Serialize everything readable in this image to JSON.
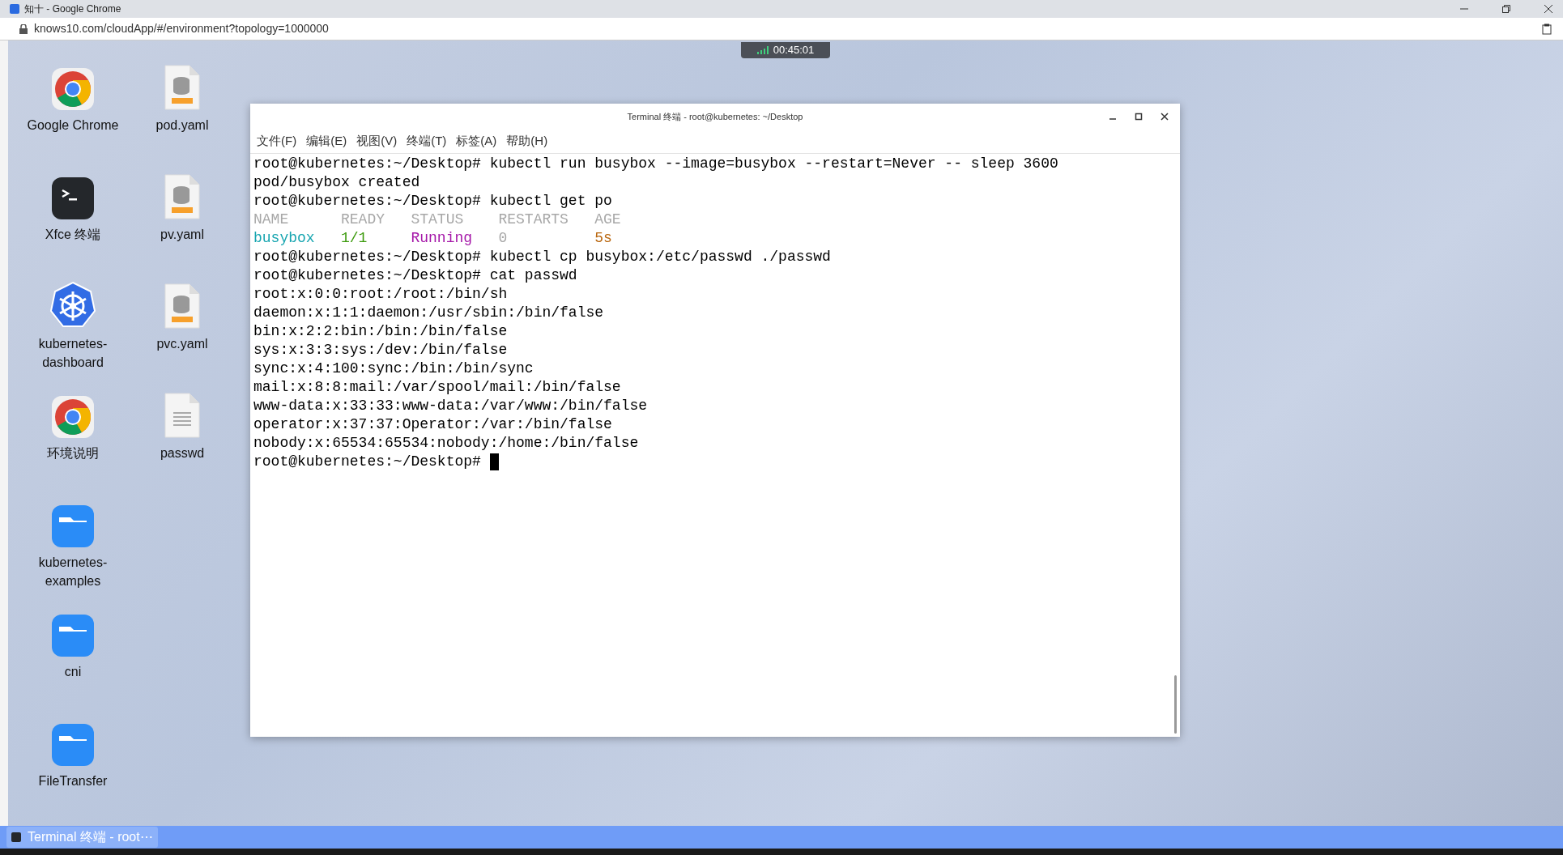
{
  "browser": {
    "title": "知十 - Google Chrome",
    "url": "knows10.com/cloudApp/#/environment?topology=1000000"
  },
  "session_timer": "00:45:01",
  "desktop_icons": [
    {
      "label": "Google Chrome",
      "kind": "chrome"
    },
    {
      "label": "pod.yaml",
      "kind": "yaml"
    },
    {
      "label": "Xfce 终端",
      "kind": "terminal"
    },
    {
      "label": "pv.yaml",
      "kind": "yaml"
    },
    {
      "label": "kubernetes-dashboard",
      "kind": "kubernetes"
    },
    {
      "label": "pvc.yaml",
      "kind": "yaml"
    },
    {
      "label": "环境说明",
      "kind": "chrome"
    },
    {
      "label": "passwd",
      "kind": "text"
    },
    {
      "label": "kubernetes-examples",
      "kind": "folder"
    },
    {
      "label": "cni",
      "kind": "folder"
    },
    {
      "label": "FileTransfer",
      "kind": "folder"
    }
  ],
  "terminal": {
    "title": "Terminal 终端 - root@kubernetes: ~/Desktop",
    "menu": [
      "文件(F)",
      "编辑(E)",
      "视图(V)",
      "终端(T)",
      "标签(A)",
      "帮助(H)"
    ],
    "lines": [
      {
        "kind": "text",
        "text": "root@kubernetes:~/Desktop# kubectl run busybox --image=busybox --restart=Never -- sleep 3600"
      },
      {
        "kind": "text",
        "text": "pod/busybox created"
      },
      {
        "kind": "text",
        "text": "root@kubernetes:~/Desktop# kubectl get po"
      },
      {
        "kind": "cells",
        "cells": [
          {
            "text": "NAME",
            "color": "#a8a8a8"
          },
          {
            "text": "READY",
            "color": "#a8a8a8"
          },
          {
            "text": "STATUS",
            "color": "#a8a8a8"
          },
          {
            "text": "RESTARTS",
            "color": "#a8a8a8"
          },
          {
            "text": "AGE",
            "color": "#a8a8a8"
          }
        ]
      },
      {
        "kind": "cells",
        "cells": [
          {
            "text": "busybox",
            "color": "#17a5b0"
          },
          {
            "text": "1/1",
            "color": "#3c9a0c"
          },
          {
            "text": "Running",
            "color": "#a517a8"
          },
          {
            "text": "0",
            "color": "#a8a8a8"
          },
          {
            "text": "5s",
            "color": "#b8650c"
          }
        ]
      },
      {
        "kind": "text",
        "text": "root@kubernetes:~/Desktop# kubectl cp busybox:/etc/passwd ./passwd"
      },
      {
        "kind": "text",
        "text": "root@kubernetes:~/Desktop# cat passwd"
      },
      {
        "kind": "text",
        "text": "root:x:0:0:root:/root:/bin/sh"
      },
      {
        "kind": "text",
        "text": "daemon:x:1:1:daemon:/usr/sbin:/bin/false"
      },
      {
        "kind": "text",
        "text": "bin:x:2:2:bin:/bin:/bin/false"
      },
      {
        "kind": "text",
        "text": "sys:x:3:3:sys:/dev:/bin/false"
      },
      {
        "kind": "text",
        "text": "sync:x:4:100:sync:/bin:/bin/sync"
      },
      {
        "kind": "text",
        "text": "mail:x:8:8:mail:/var/spool/mail:/bin/false"
      },
      {
        "kind": "text",
        "text": "www-data:x:33:33:www-data:/var/www:/bin/false"
      },
      {
        "kind": "text",
        "text": "operator:x:37:37:Operator:/var:/bin/false"
      },
      {
        "kind": "text",
        "text": "nobody:x:65534:65534:nobody:/home:/bin/false"
      },
      {
        "kind": "prompt",
        "text": "root@kubernetes:~/Desktop#"
      }
    ]
  },
  "taskbar": {
    "items": [
      {
        "label": "Terminal 终端 - root⋯",
        "selected": true
      }
    ]
  }
}
